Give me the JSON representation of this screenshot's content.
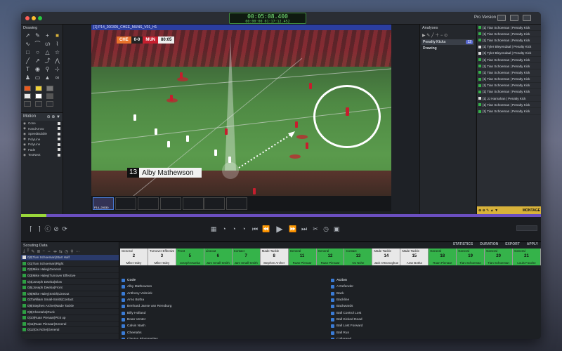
{
  "timecode": {
    "main": "00:05:08.400",
    "sub": "00:00:00     01:17:12.452"
  },
  "titlebar": {
    "pro_label": "Pro Version"
  },
  "drawing": {
    "title": "Drawing",
    "motion_title": "Motion",
    "motion_items": [
      "Cone",
      "HandArrow",
      "SpeedBubble",
      "PolyLine",
      "PolyLine",
      "Fade",
      "TextNext"
    ]
  },
  "video": {
    "title": "[1] P14_200305_CHEE_MUNS_V01_H1",
    "score": {
      "home": "CHE",
      "score": "0-0",
      "away": "MUN",
      "clock": "80:05"
    },
    "caption_number": "13",
    "caption_name": "Alby Mathewson",
    "thumb_label": "P14_20030"
  },
  "analyses": {
    "title": "Analyses",
    "items": [
      {
        "label": "Penalty Kicks",
        "badge": "12"
      },
      {
        "label": "Drawing",
        "badge": ""
      }
    ]
  },
  "right_list": {
    "items": [
      "[1] Tian Schoeman | Penalty Kick",
      "[1] Tian Schoeman | Penalty Kick",
      "[1] Tian Schoeman | Penalty Kick",
      "[1] Tyler Bleyendaal | Penalty Kick",
      "[1] Tyler Bleyendaal | Penalty Kick",
      "[1] Tian Schoeman | Penalty Kick",
      "[1] Tian Schoeman | Penalty Kick",
      "[1] Tian Schoeman | Penalty Kick",
      "[1] Tian Schoeman | Penalty Kick",
      "[1] Tian Schoeman | Penalty Kick",
      "[1] Tian Schoeman | Penalty Kick",
      "[1] JJ Hanrahan | Penalty Kick",
      "[1] Tian Schoeman | Penalty Kick",
      "[1] Tian Schoeman | Penalty Kick"
    ],
    "montage_label": "MONTAGE"
  },
  "scouting": {
    "title": "Scouting Data",
    "items": [
      "0|0|Tian Schoeman|Start Half",
      "0|1|Tian Schoeman|Right",
      "0|2|Mike Haley|General",
      "0|3|Mike Haley|Turnover Effective",
      "0|4|Joseph Dweba|Slow",
      "0|5|Joseph Dweba|Front",
      "0|6|Mike Haley|Smith|Lineout",
      "0|7|William Small-Smith|Contact",
      "0|8|Stephen Archer|Made Tackle",
      "0|9|Cheetahs|Ruck",
      "0|10|Ruan Pienaar|Pick up",
      "0|11|Ruan Pienaar|General",
      "0|12|Ox Nche|General"
    ]
  },
  "actions": {
    "statistics": "STATISTICS",
    "duration": "DURATION",
    "export": "EXPORT",
    "apply": "APPLY"
  },
  "code_bar": [
    {
      "label": "General",
      "num": "2",
      "name": "Mike Haley",
      "green": false
    },
    {
      "label": "Turnover Effective",
      "num": "3",
      "name": "Mike Haley",
      "green": false
    },
    {
      "label": "Front",
      "num": "5",
      "name": "Joseph Dweba",
      "green": true
    },
    {
      "label": "Lineout",
      "num": "6",
      "name": "Jam Small-Smith",
      "green": true
    },
    {
      "label": "Contact",
      "num": "7",
      "name": "Jam Small-Smith",
      "green": true
    },
    {
      "label": "Made Tackle",
      "num": "8",
      "name": "Stephen Archer",
      "green": false
    },
    {
      "label": "General",
      "num": "11",
      "name": "Ruan Pienaar",
      "green": true
    },
    {
      "label": "General",
      "num": "12",
      "name": "Ruan Pienaar",
      "green": true
    },
    {
      "label": "Contact",
      "num": "13",
      "name": "Ox Nche",
      "green": true
    },
    {
      "label": "Made Tackle",
      "num": "14",
      "name": "Jack O'Donoghue",
      "green": false
    },
    {
      "label": "Made Tackle",
      "num": "15",
      "name": "Aran Botha",
      "green": false
    },
    {
      "label": "General",
      "num": "18",
      "name": "Ruan Pienaar",
      "green": true
    },
    {
      "label": "General",
      "num": "19",
      "name": "Tian Schoeman",
      "green": true
    },
    {
      "label": "General",
      "num": "20",
      "name": "Tian Schoeman",
      "green": true
    },
    {
      "label": "General",
      "num": "21",
      "name": "Louis Fouche",
      "green": true
    }
  ],
  "codes_left": {
    "header": "Code",
    "items": [
      "Alby Mathewson",
      "Anthony Volmink",
      "Arno Botha",
      "Benhard Janse van Rensburg",
      "Billy Holland",
      "Boan Venter",
      "Calvin Nash",
      "Cheetahs",
      "Clayton Blommetjies",
      "Dan Goggin"
    ]
  },
  "codes_right": {
    "header": "Action",
    "items": [
      "A Defender",
      "Back",
      "Backline",
      "Backwards",
      "Ball Control Lost",
      "Ball Kicked Dead",
      "Ball Lost Forward",
      "Ball Run",
      "Collapsed",
      "Collapsing"
    ]
  },
  "colors": {
    "accent": "#2b3ea0",
    "green": "#35b34a",
    "timecode": "#7cf07c",
    "montage": "#d8b23a"
  }
}
